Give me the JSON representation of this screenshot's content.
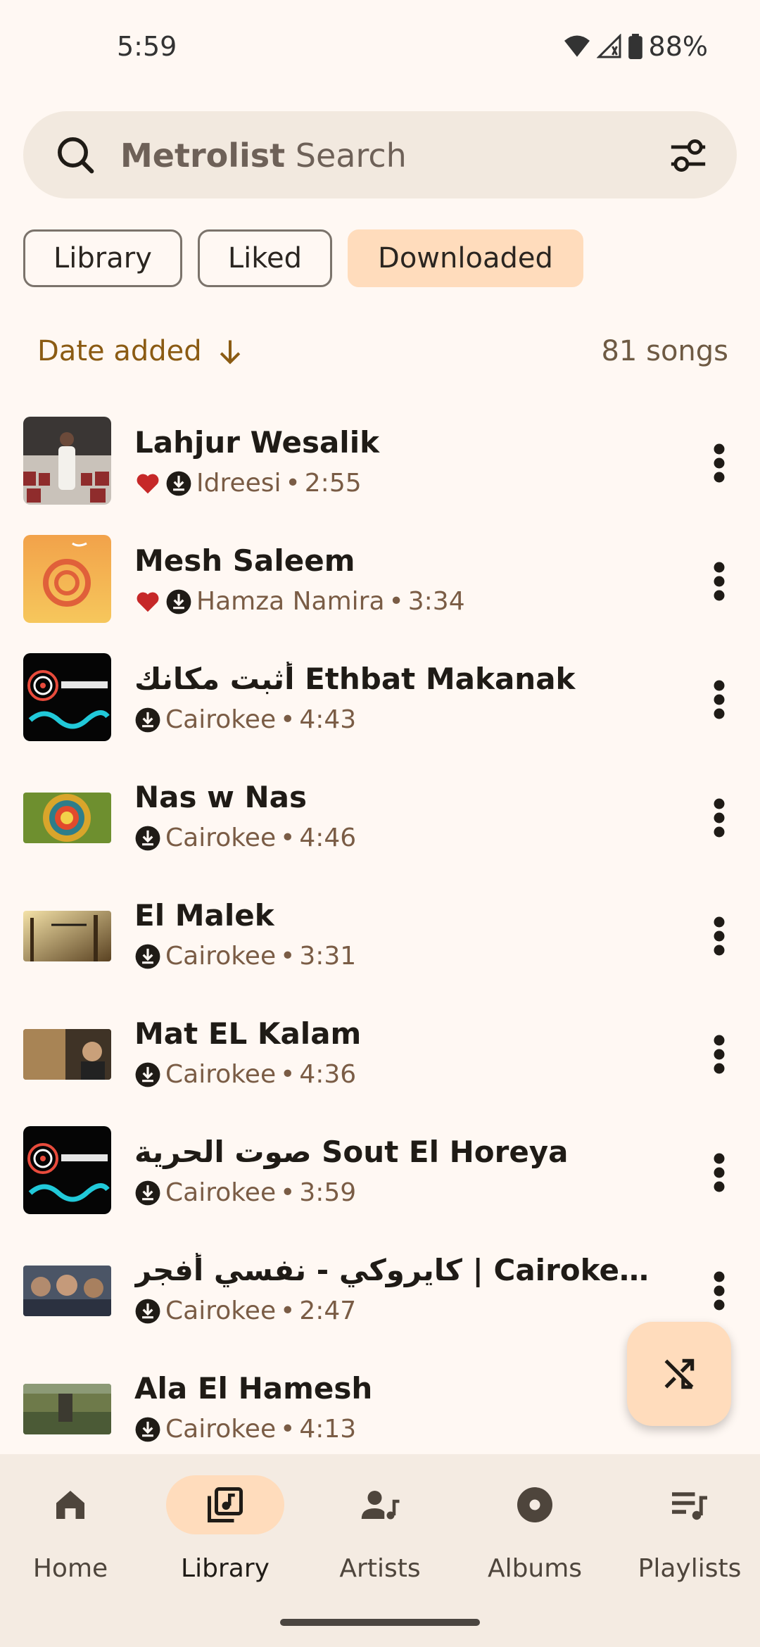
{
  "status_bar": {
    "time": "5:59",
    "battery": "88%"
  },
  "search": {
    "brand": "Metrolist",
    "placeholder": "Search"
  },
  "chips": [
    {
      "label": "Library",
      "selected": false
    },
    {
      "label": "Liked",
      "selected": false
    },
    {
      "label": "Downloaded",
      "selected": true
    }
  ],
  "sort": {
    "label": "Date added",
    "count": "81 songs"
  },
  "songs": [
    {
      "title": "Lahjur Wesalik",
      "artist": "Idreesi",
      "duration": "2:55",
      "liked": true,
      "thumb": "singer-in-theater"
    },
    {
      "title": "Mesh Saleem",
      "artist": "Hamza Namira",
      "duration": "3:34",
      "liked": true,
      "thumb": "orange-spiral-art"
    },
    {
      "title": "أثبت مكانك Ethbat Makanak",
      "artist": "Cairokee",
      "duration": "4:43",
      "liked": false,
      "thumb": "cairokee-logo"
    },
    {
      "title": "Nas w Nas",
      "artist": "Cairokee",
      "duration": "4:46",
      "liked": false,
      "thumb": "mandala-pattern"
    },
    {
      "title": "El Malek",
      "artist": "Cairokee",
      "duration": "3:31",
      "liked": false,
      "thumb": "sunlit-forest"
    },
    {
      "title": "Mat EL Kalam",
      "artist": "Cairokee",
      "duration": "4:36",
      "liked": false,
      "thumb": "singer-portrait"
    },
    {
      "title": "صوت الحرية Sout El Horeya",
      "artist": "Cairokee",
      "duration": "3:59",
      "liked": false,
      "thumb": "cairokee-logo"
    },
    {
      "title": "كايروكي  -  نفسي أفجر  | Cairokee Nefsi Afagar",
      "artist": "Cairokee",
      "duration": "2:47",
      "liked": false,
      "thumb": "band-photo"
    },
    {
      "title": "Ala El Hamesh",
      "artist": "Cairokee",
      "duration": "4:13",
      "liked": false,
      "thumb": "green-landscape"
    }
  ],
  "meta_separator": "•",
  "nav": [
    {
      "label": "Home",
      "icon": "home-icon",
      "active": false
    },
    {
      "label": "Library",
      "icon": "library-music-icon",
      "active": true
    },
    {
      "label": "Artists",
      "icon": "artist-icon",
      "active": false
    },
    {
      "label": "Albums",
      "icon": "album-icon",
      "active": false
    },
    {
      "label": "Playlists",
      "icon": "playlist-icon",
      "active": false
    }
  ],
  "colors": {
    "accent": "#FFDCBC",
    "sort_text": "#8B5B13",
    "liked": "#C62828",
    "background": "#FFF8F3"
  }
}
